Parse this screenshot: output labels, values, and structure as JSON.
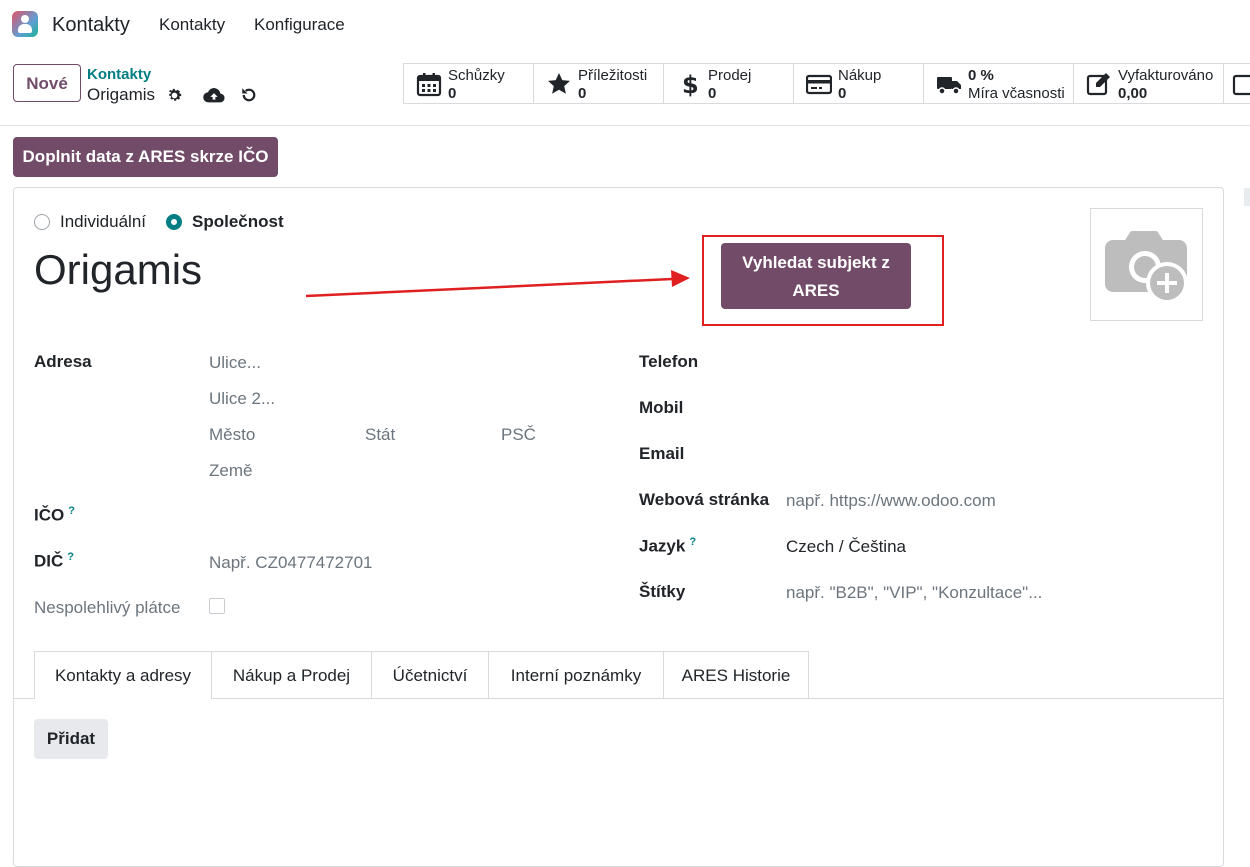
{
  "navbar": {
    "app_name": "Kontakty",
    "menu": [
      "Kontakty",
      "Konfigurace"
    ]
  },
  "control_panel": {
    "new_button": "Nové",
    "breadcrumb_parent": "Kontakty",
    "breadcrumb_current": "Origamis"
  },
  "smart_buttons": [
    {
      "label": "Schůzky",
      "value": "0",
      "icon": "calendar-icon"
    },
    {
      "label": "Příležitosti",
      "value": "0",
      "icon": "star-icon"
    },
    {
      "label": "Prodej",
      "value": "0",
      "icon": "dollar-icon"
    },
    {
      "label": "Nákup",
      "value": "0",
      "icon": "credit-card-icon"
    },
    {
      "label": "0 %",
      "value": "Míra včasnosti",
      "icon": "truck-icon"
    },
    {
      "label": "Vyfakturováno",
      "value": "0,00",
      "icon": "edit-icon"
    }
  ],
  "actions": {
    "ares_fill": "Doplnit data z ARES skrze IČO",
    "ares_search": "Vyhledat subjekt z ARES"
  },
  "form": {
    "company_type_individual": "Individuální",
    "company_type_company": "Společnost",
    "selected_type": "company",
    "name": "Origamis",
    "address_label": "Adresa",
    "street_placeholder": "Ulice...",
    "street2_placeholder": "Ulice 2...",
    "city_placeholder": "Město",
    "state_placeholder": "Stát",
    "zip_placeholder": "PSČ",
    "country_placeholder": "Země",
    "ico_label": "IČO",
    "dic_label": "DIČ",
    "dic_placeholder": "Např. CZ0477472701",
    "unreliable_label": "Nespolehlivý plátce",
    "help_mark": "?",
    "phone_label": "Telefon",
    "mobile_label": "Mobil",
    "email_label": "Email",
    "website_label": "Webová stránka",
    "website_placeholder": "např. https://www.odoo.com",
    "language_label": "Jazyk",
    "language_value": "Czech / Čeština",
    "tags_label": "Štítky",
    "tags_placeholder": "např. \"B2B\", \"VIP\", \"Konzultace\"..."
  },
  "tabs": [
    "Kontakty a adresy",
    "Nákup a Prodej",
    "Účetnictví",
    "Interní poznámky",
    "ARES Historie"
  ],
  "active_tab": 0,
  "add_button": "Přidat",
  "colors": {
    "primary": "#714b67",
    "accent": "#017e84",
    "annotation": "#e02020"
  }
}
